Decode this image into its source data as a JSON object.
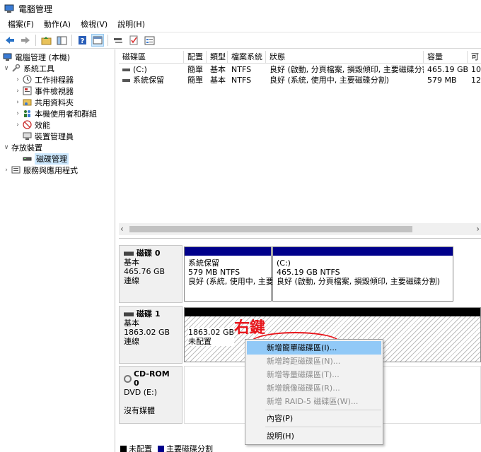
{
  "window": {
    "title": "電腦管理"
  },
  "menu": [
    "檔案(F)",
    "動作(A)",
    "檢視(V)",
    "說明(H)"
  ],
  "toolbar": {
    "buttons": [
      "back-icon",
      "forward-icon",
      "up-folder-icon",
      "show-hide-tree-icon",
      "help-icon",
      "view-icon",
      "connect-icon",
      "check-icon",
      "properties-icon"
    ]
  },
  "tree": {
    "root": "電腦管理 (本機)",
    "items": [
      {
        "label": "系統工具",
        "level": 1,
        "expanded": true
      },
      {
        "label": "工作排程器",
        "level": 2
      },
      {
        "label": "事件檢視器",
        "level": 2
      },
      {
        "label": "共用資料夾",
        "level": 2
      },
      {
        "label": "本機使用者和群組",
        "level": 2
      },
      {
        "label": "效能",
        "level": 2
      },
      {
        "label": "裝置管理員",
        "level": 2
      },
      {
        "label": "存放裝置",
        "level": 1,
        "expanded": true
      },
      {
        "label": "磁碟管理",
        "level": 2,
        "selected": true
      },
      {
        "label": "服務與應用程式",
        "level": 1
      }
    ]
  },
  "volume_list": {
    "columns": [
      "磁碟區",
      "配置",
      "類型",
      "檔案系統",
      "狀態",
      "容量",
      "可"
    ],
    "rows": [
      [
        "(C:)",
        "簡單",
        "基本",
        "NTFS",
        "良好 (啟動, 分頁檔案, 損毀傾印, 主要磁碟分割)",
        "465.19 GB",
        "10"
      ],
      [
        "系統保留",
        "簡單",
        "基本",
        "NTFS",
        "良好 (系統, 使用中, 主要磁碟分割)",
        "579 MB",
        "12"
      ]
    ]
  },
  "disks": [
    {
      "name": "磁碟 0",
      "type": "基本",
      "size": "465.76 GB",
      "state": "連線",
      "partitions": [
        {
          "name": "系統保留",
          "size": "579 MB NTFS",
          "status": "良好 (系統, 使用中, 主要"
        },
        {
          "name": "(C:)",
          "size": "465.19 GB NTFS",
          "status": "良好 (啟動, 分頁檔案, 損毀傾印, 主要磁碟分割)"
        }
      ]
    },
    {
      "name": "磁碟 1",
      "type": "基本",
      "size": "1863.02 GB",
      "state": "連線",
      "partitions": [
        {
          "name": "",
          "size": "1863.02 GB",
          "status": "未配置"
        }
      ]
    },
    {
      "name": "CD-ROM 0",
      "type": "DVD (E:)",
      "size": "",
      "state": "沒有媒體"
    }
  ],
  "context_menu": {
    "items": [
      {
        "label": "新增簡單磁碟區(I)...",
        "enabled": true,
        "highlighted": true
      },
      {
        "label": "新增跨距磁碟區(N)...",
        "enabled": false
      },
      {
        "label": "新增等量磁碟區(T)...",
        "enabled": false
      },
      {
        "label": "新增鏡像磁碟區(R)...",
        "enabled": false
      },
      {
        "label": "新增 RAID-5 磁碟區(W)...",
        "enabled": false
      },
      {
        "label": "內容(P)",
        "enabled": true
      },
      {
        "label": "說明(H)",
        "enabled": true
      }
    ]
  },
  "annotation": {
    "text": "右鍵",
    "color": "#e8151b"
  },
  "legend": [
    {
      "label": "未配置",
      "color": "#000000"
    },
    {
      "label": "主要磁碟分割",
      "color": "#00008b"
    }
  ],
  "colors": {
    "primary_partition": "#00008b",
    "unallocated": "#000000",
    "menu_highlight": "#91c9f7",
    "selection": "#cce8ff"
  }
}
